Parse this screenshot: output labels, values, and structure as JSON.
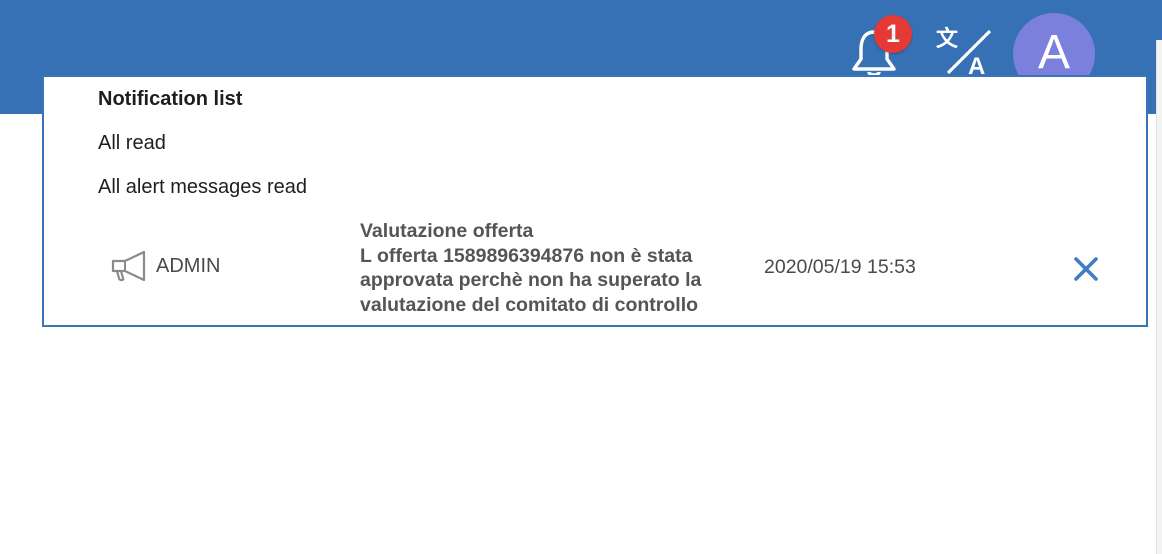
{
  "header": {
    "notifications_count": "1",
    "avatar_initial": "A",
    "icons": {
      "notifications": "bell-icon",
      "language": "translate-icon"
    },
    "colors": {
      "bar": "#3571b4",
      "badge": "#e53935",
      "avatar": "#7b80dc"
    }
  },
  "notification_panel": {
    "title": "Notification list",
    "all_read": "All read",
    "all_alerts_read": "All alert messages read",
    "items": [
      {
        "icon": "megaphone-icon",
        "sender": "ADMIN",
        "message_lines": [
          "Valutazione offerta",
          "L offerta 1589896394876 non è stata",
          "approvata perchè non ha superato la",
          "valutazione del comitato di controllo"
        ],
        "timestamp": "2020/05/19 15:53",
        "close_icon": "close-icon",
        "close_color": "#3f7dc4"
      }
    ]
  }
}
